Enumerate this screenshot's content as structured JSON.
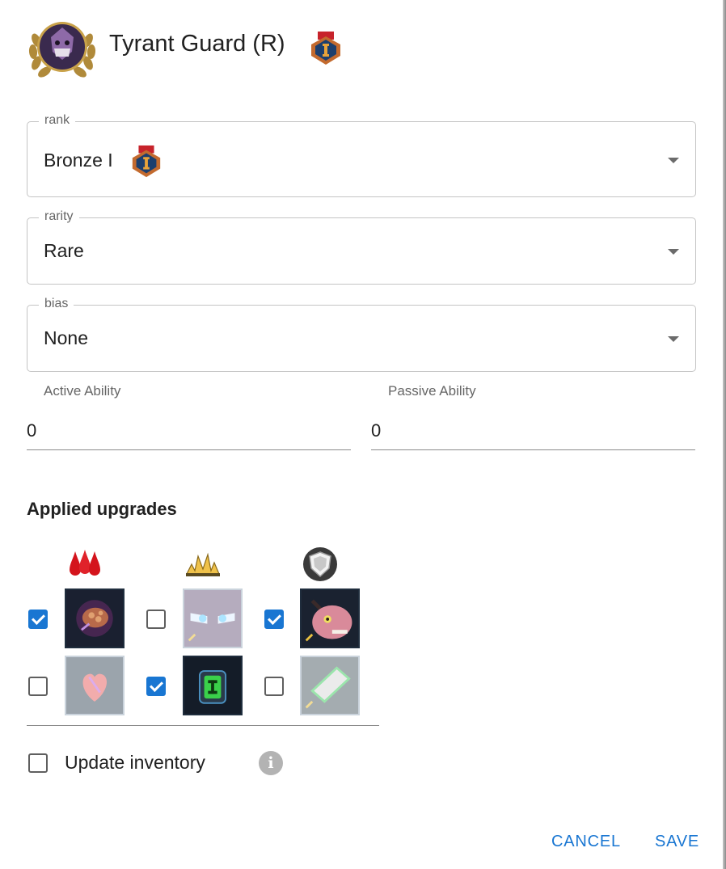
{
  "header": {
    "title": "Tyrant Guard  (R)",
    "avatar_icon": "laurel-portrait-icon",
    "rank_icon": "bronze-rank-badge-icon"
  },
  "fields": {
    "rank": {
      "label": "rank",
      "value": "Bronze I",
      "badge_icon": "bronze-rank-badge-icon"
    },
    "rarity": {
      "label": "rarity",
      "value": "Rare"
    },
    "bias": {
      "label": "bias",
      "value": "None"
    }
  },
  "abilities": {
    "active": {
      "label": "Active Ability",
      "value": "0"
    },
    "passive": {
      "label": "Passive Ability",
      "value": "0"
    }
  },
  "upgrades": {
    "heading": "Applied upgrades",
    "columns": [
      {
        "icon": "blood-drops-icon",
        "items": [
          {
            "checked": true,
            "icon": "brain-organ-icon"
          },
          {
            "checked": false,
            "icon": "heart-organ-icon"
          }
        ]
      },
      {
        "icon": "burst-icon",
        "items": [
          {
            "checked": false,
            "icon": "glowing-eyes-icon"
          },
          {
            "checked": true,
            "icon": "power-cell-icon"
          }
        ]
      },
      {
        "icon": "shield-icon",
        "items": [
          {
            "checked": true,
            "icon": "horned-beast-icon"
          },
          {
            "checked": false,
            "icon": "metal-bar-icon"
          }
        ]
      }
    ]
  },
  "inventory": {
    "label": "Update inventory",
    "checked": false,
    "info_icon": "info-icon"
  },
  "actions": {
    "cancel_label": "CANCEL",
    "save_label": "SAVE"
  },
  "colors": {
    "accent": "#1976d2",
    "checkbox_off": "#5f5f5f"
  }
}
